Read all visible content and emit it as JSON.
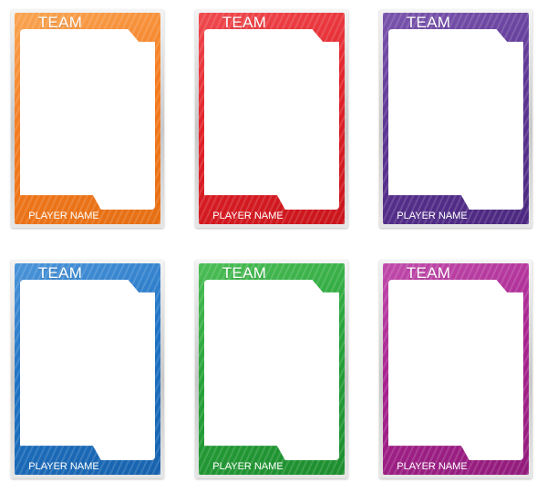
{
  "cards": [
    {
      "team": "TEAM",
      "player": "PLAYER NAME",
      "color": "#f47b20",
      "light": "#f9a552",
      "dark": "#e56e12"
    },
    {
      "team": "TEAM",
      "player": "PLAYER NAME",
      "color": "#e2232a",
      "light": "#ef4a4f",
      "dark": "#c9141b"
    },
    {
      "team": "TEAM",
      "player": "PLAYER NAME",
      "color": "#5d3594",
      "light": "#7a55ad",
      "dark": "#4b2880"
    },
    {
      "team": "TEAM",
      "player": "PLAYER NAME",
      "color": "#1f73c4",
      "light": "#4b94d8",
      "dark": "#1762ad"
    },
    {
      "team": "TEAM",
      "player": "PLAYER NAME",
      "color": "#27a33a",
      "light": "#4bbd55",
      "dark": "#1d8d2e"
    },
    {
      "team": "TEAM",
      "player": "PLAYER NAME",
      "color": "#a8238f",
      "light": "#c04bab",
      "dark": "#921b7b"
    }
  ]
}
